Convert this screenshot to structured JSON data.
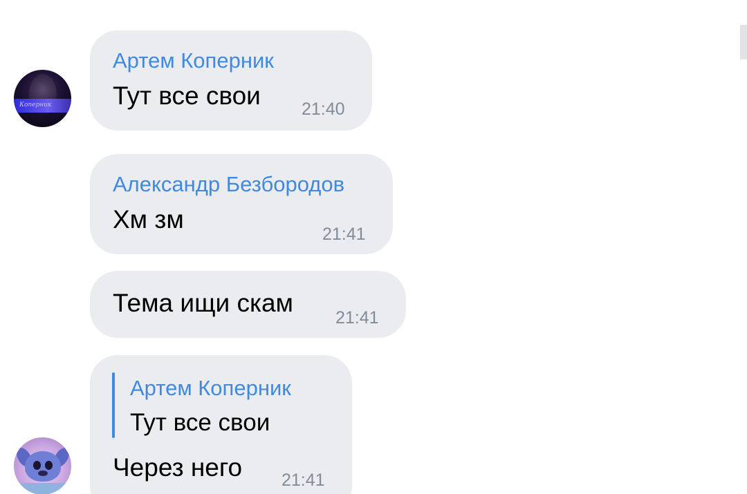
{
  "messages": [
    {
      "sender": "Артем Коперник",
      "text": "Тут все свои",
      "time": "21:40"
    },
    {
      "sender": "Александр Безбородов",
      "text": "Хм зм",
      "time": "21:41"
    },
    {
      "text": "Тема ищи скам",
      "time": "21:41"
    },
    {
      "reply": {
        "sender": "Артем Коперник",
        "text": "Тут все свои"
      },
      "text": "Через него",
      "time": "21:41"
    }
  ],
  "avatars": [
    {
      "label": "Коперник"
    },
    {}
  ],
  "colors": {
    "bubble": "#ebecf0",
    "sender": "#3f8ae0",
    "time": "#818c99",
    "text": "#000000",
    "quote_bar": "#3f8ae0"
  }
}
